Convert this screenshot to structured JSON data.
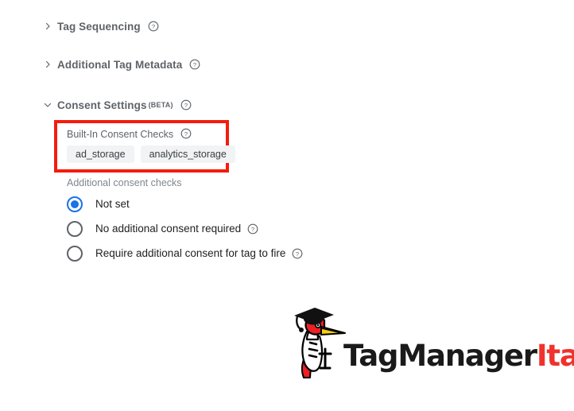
{
  "sections": [
    {
      "id": "tag-sequencing",
      "label": "Tag Sequencing",
      "expanded": false,
      "chevron": "chevron-right-icon",
      "help": "help-icon"
    },
    {
      "id": "additional-metadata",
      "label": "Additional Tag Metadata",
      "expanded": false,
      "chevron": "chevron-right-icon",
      "help": "help-icon"
    },
    {
      "id": "consent-settings",
      "label": "Consent Settings",
      "badge": "(BETA)",
      "expanded": true,
      "chevron": "chevron-down-icon",
      "help": "help-icon"
    }
  ],
  "consent_settings": {
    "builtin": {
      "label": "Built-In Consent Checks",
      "help": "help-icon",
      "chips": [
        "ad_storage",
        "analytics_storage"
      ],
      "highlight_color": "#f41c0d"
    },
    "additional": {
      "label": "Additional consent checks",
      "selected_index": 0,
      "options": [
        {
          "label": "Not set",
          "checked": true,
          "help": false
        },
        {
          "label": "No additional consent required",
          "checked": false,
          "help": true
        },
        {
          "label": "Require additional consent for tag to fire",
          "checked": false,
          "help": true
        }
      ]
    }
  },
  "logo": {
    "mark": "woodpecker-graduate-icon",
    "text_primary": "TagManager",
    "text_accent": "Italia",
    "primary_color": "#1a1a1a",
    "accent_color": "#f0322c"
  }
}
